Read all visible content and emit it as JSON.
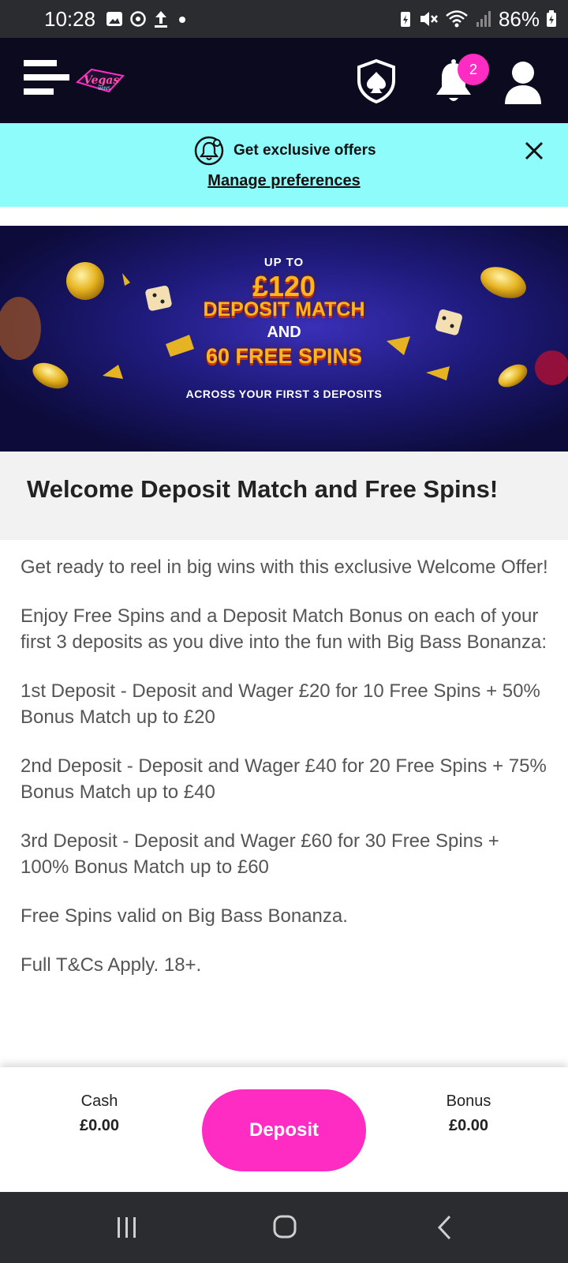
{
  "status_bar": {
    "time": "10:28",
    "battery": "86%"
  },
  "header": {
    "logo_text": "Vegas",
    "logo_subtext": "WINS",
    "notification_count": "2"
  },
  "offers_banner": {
    "text": "Get exclusive offers",
    "link": "Manage preferences"
  },
  "promo": {
    "line1": "UP TO",
    "line2": "£120",
    "line3": "DEPOSIT MATCH",
    "line4": "AND",
    "line5": "60 FREE SPINS",
    "line6": "ACROSS YOUR FIRST 3 DEPOSITS"
  },
  "page": {
    "title": "Welcome Deposit Match and Free Spins!",
    "paragraphs": [
      "Get ready to reel in big wins with this exclusive Welcome Offer!",
      "Enjoy Free Spins and a Deposit Match Bonus on each of your first 3 deposits as you dive into the fun with Big Bass Bonanza:",
      "1st Deposit - Deposit and Wager £20 for 10 Free Spins + 50% Bonus Match up to £20",
      "2nd Deposit - Deposit and Wager £40 for 20 Free Spins + 75% Bonus Match up to £40",
      "3rd Deposit - Deposit and Wager £60 for 30 Free Spins + 100% Bonus Match up to £60",
      "Free Spins valid on Big Bass Bonanza.",
      "Full T&Cs Apply. 18+."
    ]
  },
  "balance": {
    "cash_label": "Cash",
    "cash_value": "£0.00",
    "deposit_label": "Deposit",
    "bonus_label": "Bonus",
    "bonus_value": "£0.00"
  },
  "colors": {
    "accent": "#ff2cc4",
    "header_bg": "#0c0a1e",
    "offers_bg": "#8ffcfc"
  }
}
